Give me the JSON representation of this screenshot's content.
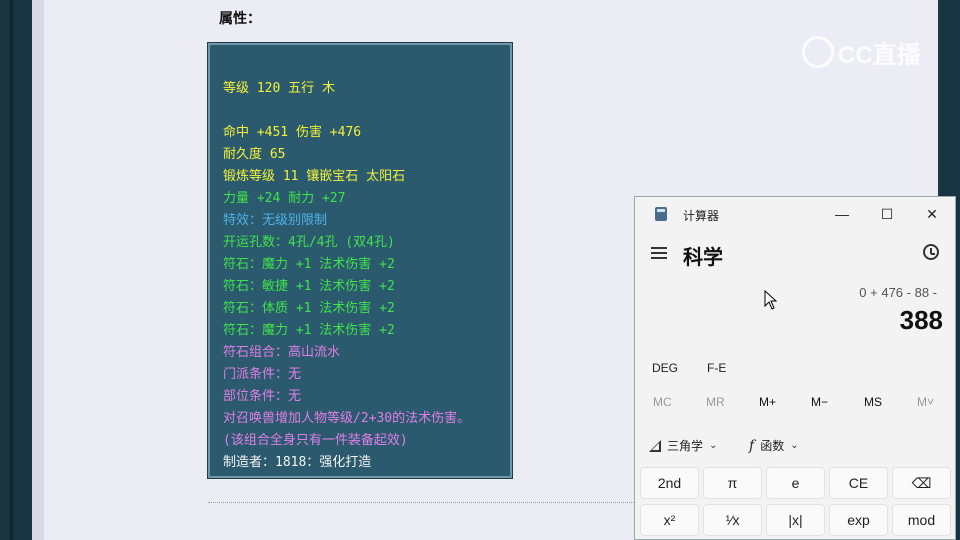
{
  "page": {
    "attributes_label": "属性：",
    "item_lines": [
      {
        "text": "等级 120 五行 木",
        "color": "yellow"
      },
      {
        "text": "命中 +451 伤害 +476",
        "color": "yellow"
      },
      {
        "text": "耐久度 65",
        "color": "yellow"
      },
      {
        "text": "锻炼等级 11 镶嵌宝石 太阳石",
        "color": "yellow"
      },
      {
        "text": "力量 +24 耐力 +27",
        "color": "green"
      },
      {
        "text": "特效：无级别限制",
        "color": "blue"
      },
      {
        "text": "开运孔数：4孔/4孔 (双4孔)",
        "color": "green"
      },
      {
        "text": "符石：魔力 +1 法术伤害 +2",
        "color": "green"
      },
      {
        "text": "符石：敏捷 +1 法术伤害 +2",
        "color": "green"
      },
      {
        "text": "符石：体质 +1 法术伤害 +2",
        "color": "green"
      },
      {
        "text": "符石：魔力 +1 法术伤害 +2",
        "color": "green"
      },
      {
        "text": "符石组合：高山流水",
        "color": "purple"
      },
      {
        "text": "门派条件：无",
        "color": "purple"
      },
      {
        "text": "部位条件：无",
        "color": "purple"
      },
      {
        "text": "对召唤兽增加人物等级/2+30的法术伤害。",
        "color": "purple"
      },
      {
        "text": "(该组合全身只有一件装备起效)",
        "color": "purple"
      },
      {
        "text": "制造者：1818：强化打造",
        "color": "white"
      }
    ]
  },
  "watermark": {
    "text": "CC直播"
  },
  "calculator": {
    "app_title": "计算器",
    "mode": "科学",
    "expression": "0 + 476 - 88 -",
    "result": "388",
    "window_buttons": {
      "minimize": "—",
      "maximize": "☐",
      "close": "✕"
    },
    "angle_unit": "DEG",
    "notation": "F-E",
    "memory": [
      "MC",
      "MR",
      "M+",
      "M−",
      "MS",
      "M˅"
    ],
    "memory_disabled": [
      true,
      true,
      false,
      false,
      false,
      true
    ],
    "trig_label": "三角学",
    "func_label": "函数",
    "keys_row1": [
      "2nd",
      "π",
      "e",
      "CE",
      "⌫"
    ],
    "keys_row2": [
      "x²",
      "¹⁄x",
      "|x|",
      "exp",
      "mod"
    ]
  },
  "icons": {
    "app": "calculator-app-icon",
    "menu": "hamburger-icon",
    "history": "history-icon",
    "trig": "triangle-icon",
    "func": "fx-icon",
    "cursor": "mouse-cursor-icon"
  }
}
